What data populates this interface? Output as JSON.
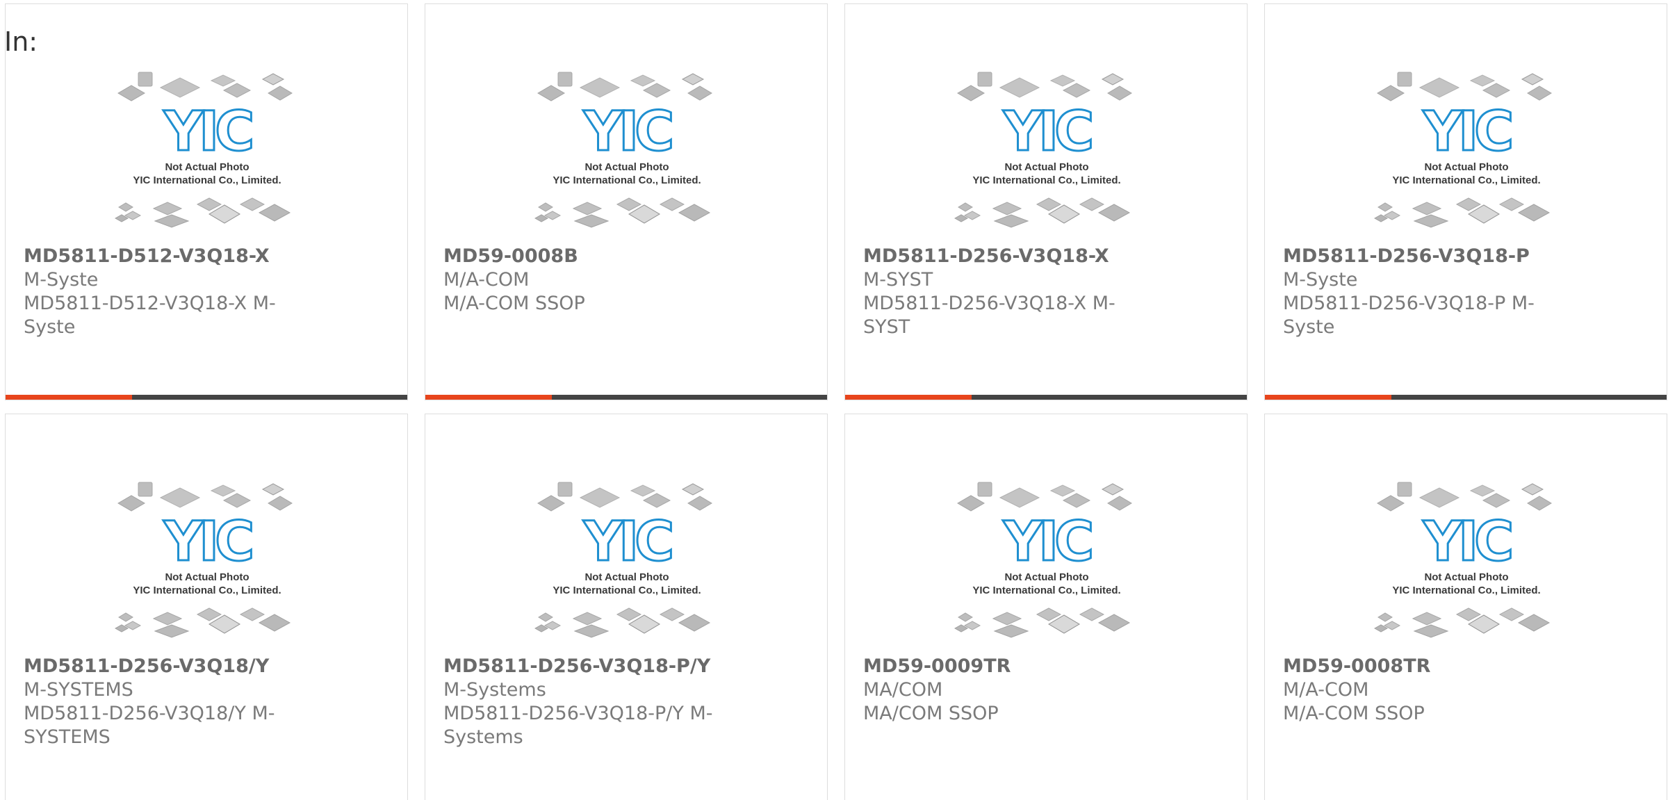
{
  "filter": {
    "label": "In:"
  },
  "image": {
    "logo_text": "YIC",
    "caption_line1": "Not Actual Photo",
    "caption_line2": "YIC International Co., Limited."
  },
  "colors": {
    "accent": "#e8451c",
    "bar": "#444444",
    "logo": "#1f8fd0"
  },
  "products": [
    {
      "part": "MD5811-D512-V3Q18-X",
      "manufacturer": "M-Syste",
      "description": "MD5811-D512-V3Q18-X M-Syste"
    },
    {
      "part": "MD59-0008B",
      "manufacturer": "M/A-COM",
      "description": "M/A-COM SSOP"
    },
    {
      "part": "MD5811-D256-V3Q18-X",
      "manufacturer": "M-SYST",
      "description": "MD5811-D256-V3Q18-X M-SYST"
    },
    {
      "part": "MD5811-D256-V3Q18-P",
      "manufacturer": "M-Syste",
      "description": "MD5811-D256-V3Q18-P M-Syste"
    },
    {
      "part": "MD5811-D256-V3Q18/Y",
      "manufacturer": "M-SYSTEMS",
      "description": "MD5811-D256-V3Q18/Y M-SYSTEMS"
    },
    {
      "part": "MD5811-D256-V3Q18-P/Y",
      "manufacturer": "M-Systems",
      "description": "MD5811-D256-V3Q18-P/Y M-Systems"
    },
    {
      "part": "MD59-0009TR",
      "manufacturer": "MA/COM",
      "description": "MA/COM SSOP"
    },
    {
      "part": "MD59-0008TR",
      "manufacturer": "M/A-COM",
      "description": "M/A-COM SSOP"
    }
  ]
}
